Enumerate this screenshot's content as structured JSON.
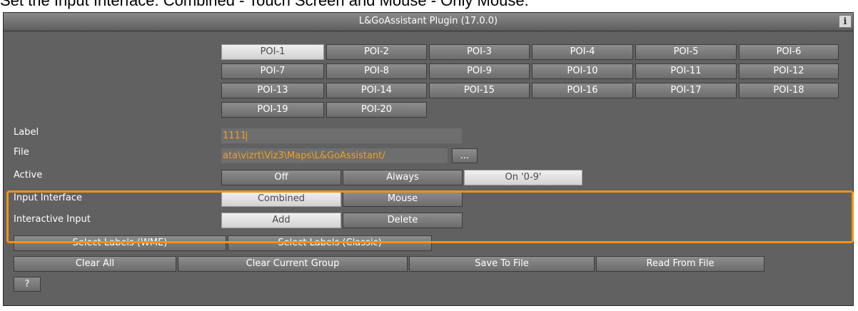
{
  "caption": "Set the Input Interface: Combined - Touch Screen and Mouse - Only Mouse.",
  "window": {
    "title": "L&GoAssistant Plugin (17.0.0)",
    "info_icon_glyph": "i"
  },
  "poi_buttons": [
    "POI-1",
    "POI-2",
    "POI-3",
    "POI-4",
    "POI-5",
    "POI-6",
    "POI-7",
    "POI-8",
    "POI-9",
    "POI-10",
    "POI-11",
    "POI-12",
    "POI-13",
    "POI-14",
    "POI-15",
    "POI-16",
    "POI-17",
    "POI-18",
    "POI-19",
    "POI-20"
  ],
  "selected_poi": "POI-1",
  "label_field": {
    "label": "Label",
    "value": "1111"
  },
  "file_field": {
    "label": "File",
    "value": "ata\\vizrt\\Viz3\\Maps\\L&GoAssistant/",
    "browse_label": "..."
  },
  "active": {
    "label": "Active",
    "options": [
      "Off",
      "Always",
      "On '0-9'"
    ],
    "selected": "On '0-9'"
  },
  "input_interface": {
    "label": "Input Interface",
    "options": [
      "Combined",
      "Mouse"
    ],
    "selected": "Combined"
  },
  "interactive_input": {
    "label": "Interactive Input",
    "options": [
      "Add",
      "Delete"
    ],
    "selected": "Add"
  },
  "select_labels": [
    "Select Labels (WME)",
    "Select Labels (Classic)"
  ],
  "actions": [
    "Clear All",
    "Clear Current Group",
    "Save To File",
    "Read From File"
  ],
  "help_label": "?",
  "highlight_color": "#f39214"
}
